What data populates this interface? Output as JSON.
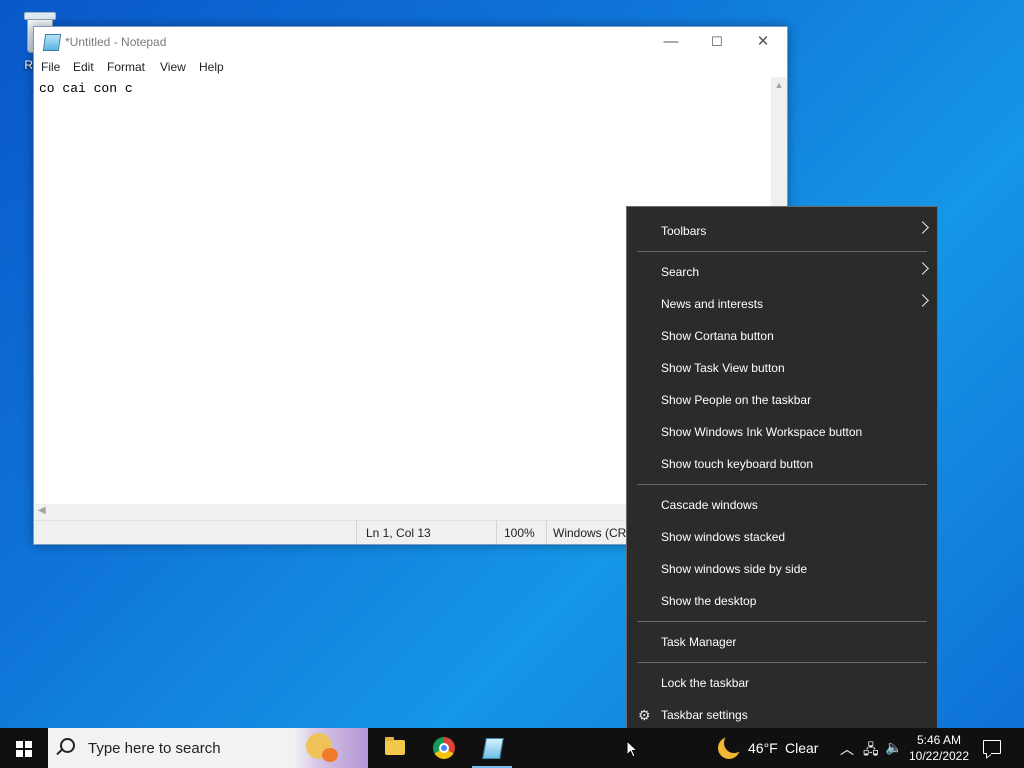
{
  "desktop": {
    "recycle_bin_label": "Recy"
  },
  "notepad": {
    "title": "*Untitled - Notepad",
    "controls": {
      "minimize": "—",
      "maximize": "☐",
      "close": "✕"
    },
    "menu": [
      "File",
      "Edit",
      "Format",
      "View",
      "Help"
    ],
    "content": "co cai con c",
    "status": {
      "position": "Ln 1, Col 13",
      "zoom": "100%",
      "encoding": "Windows (CRL"
    }
  },
  "context_menu": {
    "groups": [
      [
        {
          "label": "Toolbars",
          "submenu": true
        }
      ],
      [
        {
          "label": "Search",
          "submenu": true
        },
        {
          "label": "News and interests",
          "submenu": true
        },
        {
          "label": "Show Cortana button",
          "submenu": false
        },
        {
          "label": "Show Task View button",
          "submenu": false
        },
        {
          "label": "Show People on the taskbar",
          "submenu": false
        },
        {
          "label": "Show Windows Ink Workspace button",
          "submenu": false
        },
        {
          "label": "Show touch keyboard button",
          "submenu": false
        }
      ],
      [
        {
          "label": "Cascade windows",
          "submenu": false
        },
        {
          "label": "Show windows stacked",
          "submenu": false
        },
        {
          "label": "Show windows side by side",
          "submenu": false
        },
        {
          "label": "Show the desktop",
          "submenu": false
        }
      ],
      [
        {
          "label": "Task Manager",
          "submenu": false
        }
      ],
      [
        {
          "label": "Lock the taskbar",
          "submenu": false
        },
        {
          "label": "Taskbar settings",
          "submenu": false,
          "icon": "gear-icon"
        }
      ]
    ]
  },
  "taskbar": {
    "search_placeholder": "Type here to search",
    "apps": [
      "file-explorer-icon",
      "chrome-icon",
      "notepad-icon"
    ],
    "weather": {
      "temperature": "46°F",
      "condition": "Clear",
      "icon": "moon-icon"
    },
    "tray_icons": [
      "chevron-up-icon",
      "network-icon",
      "volume-icon"
    ],
    "clock": {
      "time": "5:46 AM",
      "date": "10/22/2022"
    }
  }
}
